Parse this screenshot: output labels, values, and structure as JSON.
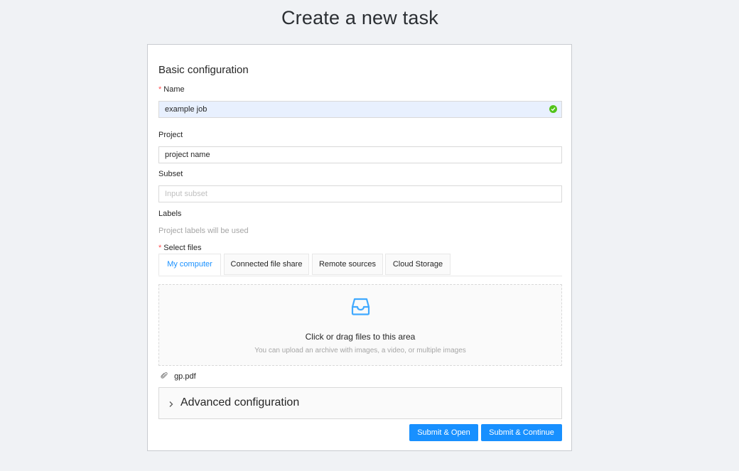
{
  "page": {
    "title": "Create a new task"
  },
  "basic": {
    "title": "Basic configuration",
    "name_label": "Name",
    "name_value": "example job",
    "project_label": "Project",
    "project_value": "project name",
    "subset_label": "Subset",
    "subset_placeholder": "Input subset",
    "labels_label": "Labels",
    "labels_hint": "Project labels will be used"
  },
  "files": {
    "label": "Select files",
    "tabs": [
      {
        "label": "My computer",
        "active": true
      },
      {
        "label": "Connected file share",
        "active": false
      },
      {
        "label": "Remote sources",
        "active": false
      },
      {
        "label": "Cloud Storage",
        "active": false
      }
    ],
    "dropzone_text": "Click or drag files to this area",
    "dropzone_hint": "You can upload an archive with images, a video, or multiple images",
    "uploaded": [
      "gp.pdf"
    ]
  },
  "advanced": {
    "title": "Advanced configuration"
  },
  "actions": {
    "submit_open": "Submit & Open",
    "submit_continue": "Submit & Continue"
  },
  "colors": {
    "accent": "#1890ff",
    "success": "#52c41a",
    "required": "#ff4d4f",
    "background": "#f0f2f5"
  }
}
